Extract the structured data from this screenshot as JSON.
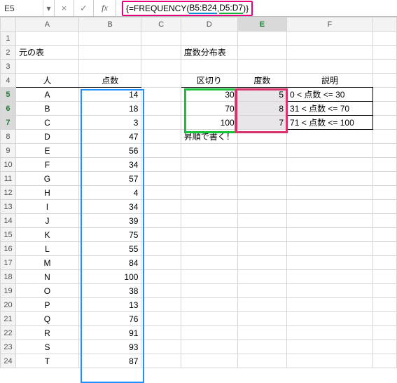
{
  "formula_bar": {
    "name_box": "E5",
    "cancel": "×",
    "confirm": "✓",
    "fx": "fx",
    "formula_prefix": "{=FREQUENCY(",
    "arg1": "B5:B24",
    "comma": ",",
    "arg2": "D5:D7",
    "formula_suffix": ")}"
  },
  "columns": [
    "A",
    "B",
    "C",
    "D",
    "E",
    "F"
  ],
  "row_numbers": [
    "1",
    "2",
    "3",
    "4",
    "5",
    "6",
    "7",
    "8",
    "9",
    "10",
    "11",
    "12",
    "13",
    "14",
    "15",
    "16",
    "17",
    "18",
    "19",
    "20",
    "21",
    "22",
    "23",
    "24"
  ],
  "selected_rows": [
    "5",
    "6",
    "7"
  ],
  "selected_col": "E",
  "labels": {
    "source_title": "元の表",
    "freq_title": "度数分布表",
    "person": "人",
    "score": "点数",
    "bin": "区切り",
    "freq": "度数",
    "desc": "説明",
    "asc_note": "昇順で書く！"
  },
  "people": [
    {
      "name": "A",
      "score": 14
    },
    {
      "name": "B",
      "score": 18
    },
    {
      "name": "C",
      "score": 3
    },
    {
      "name": "D",
      "score": 47
    },
    {
      "name": "E",
      "score": 56
    },
    {
      "name": "F",
      "score": 34
    },
    {
      "name": "G",
      "score": 57
    },
    {
      "name": "H",
      "score": 4
    },
    {
      "name": "I",
      "score": 34
    },
    {
      "name": "J",
      "score": 39
    },
    {
      "name": "K",
      "score": 75
    },
    {
      "name": "L",
      "score": 55
    },
    {
      "name": "M",
      "score": 84
    },
    {
      "name": "N",
      "score": 100
    },
    {
      "name": "O",
      "score": 38
    },
    {
      "name": "P",
      "score": 13
    },
    {
      "name": "Q",
      "score": 76
    },
    {
      "name": "R",
      "score": 91
    },
    {
      "name": "S",
      "score": 93
    },
    {
      "name": "T",
      "score": 87
    }
  ],
  "bins": [
    {
      "edge": 30,
      "freq": 5,
      "desc": "0 < 点数 <= 30"
    },
    {
      "edge": 70,
      "freq": 8,
      "desc": "31 < 点数 <= 70"
    },
    {
      "edge": 100,
      "freq": 7,
      "desc": "71 < 点数 <= 100"
    }
  ],
  "chart_data": {
    "type": "table",
    "title": "度数分布表",
    "categories": [
      "0 < 点数 <= 30",
      "31 < 点数 <= 70",
      "71 < 点数 <= 100"
    ],
    "values": [
      5,
      8,
      7
    ],
    "bin_edges": [
      30,
      70,
      100
    ],
    "source_series": {
      "name": "点数",
      "values": [
        14,
        18,
        3,
        47,
        56,
        34,
        57,
        4,
        34,
        39,
        75,
        55,
        84,
        100,
        38,
        13,
        76,
        91,
        93,
        87
      ]
    }
  },
  "colors": {
    "blue": "#1e90ff",
    "green": "#16c23a",
    "pink": "#d6336c",
    "magenta": "#e6007e"
  }
}
